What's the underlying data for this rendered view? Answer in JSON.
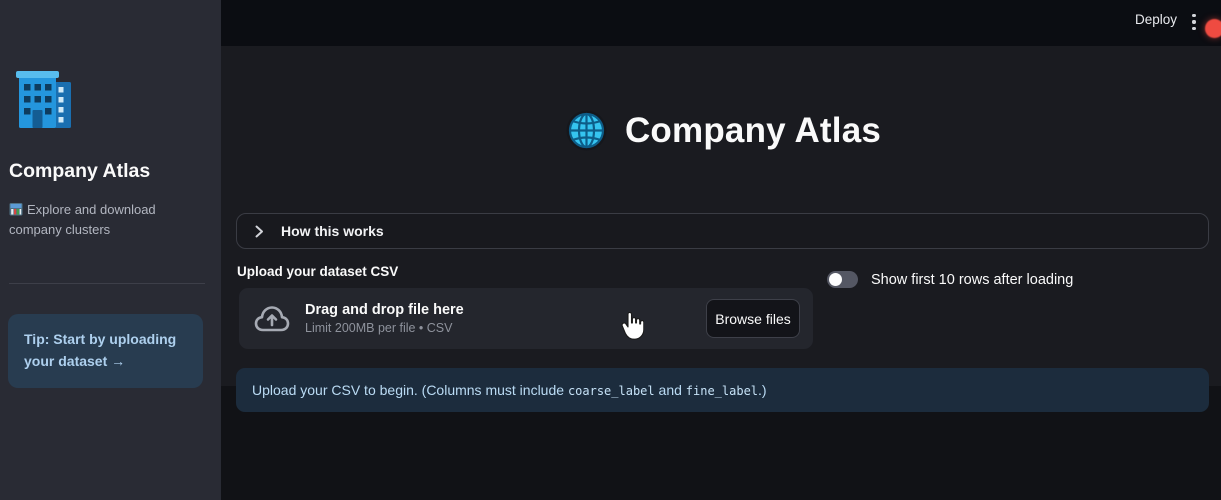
{
  "header": {
    "deploy_label": "Deploy"
  },
  "sidebar": {
    "app_icon": "office-building-emoji",
    "title": "Company Atlas",
    "description_icon": "department-store-emoji",
    "description": "Explore and download company clusters",
    "tip": "Tip: Start by uploading your dataset →"
  },
  "main": {
    "title_icon": "globe-with-meridians-emoji",
    "title": "Company Atlas",
    "expander": {
      "label": "How this works",
      "state": "collapsed"
    },
    "uploader": {
      "label": "Upload your dataset CSV",
      "dropzone_primary": "Drag and drop file here",
      "dropzone_secondary": "Limit 200MB per file • CSV",
      "browse_button": "Browse files"
    },
    "toggle": {
      "label": "Show first 10 rows after loading",
      "state": "off"
    },
    "info": {
      "prefix": "Upload your CSV to begin. (Columns must include ",
      "code1": "coarse_label",
      "middle": " and ",
      "code2": "fine_label",
      "suffix": ".)"
    }
  },
  "colors": {
    "sidebar_bg": "#292b34",
    "header_bg": "#0b0d12",
    "content_bg": "#1a1b20",
    "page_bg": "#111216",
    "dropzone_bg": "#24262d",
    "info_bg": "#1c2c3d",
    "info_text": "#badbf4",
    "tip_bg": "#283c50",
    "tip_text": "#aed0ee",
    "record_dot": "#ef4b41",
    "globe_cyan": "#35c4f0",
    "building_blue": "#2496dd"
  }
}
